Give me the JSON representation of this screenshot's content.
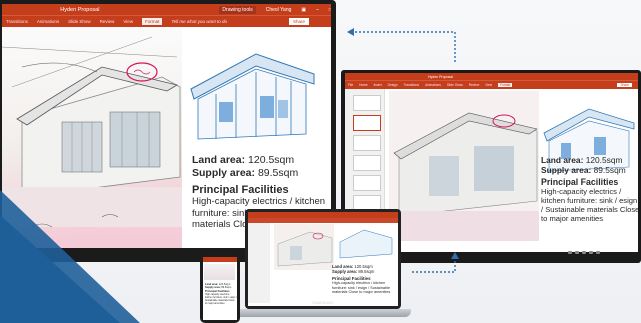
{
  "ppt": {
    "title": "Hyden Proposal",
    "context_tag": "Drawing tools",
    "user": "Cheol Yang",
    "tabs": [
      "Transitions",
      "Animations",
      "Slide Show",
      "Review",
      "View",
      "Format"
    ],
    "active_tab": "Format",
    "tell_me": "Tell me what you want to do",
    "share": "Share"
  },
  "slide": {
    "land_label": "Land area:",
    "land_value": "120.5sqm",
    "supply_label": "Supply area:",
    "supply_value": "89.5sqm",
    "section": "Principal Facilities",
    "description_main": "High-capacity electrics / kitchen furniture: sink / esign / Sustainable materials Close to major amenities",
    "description_right": "High-capacity electrics / kitchen furniture: sink / esign / Sustainable materials Close to major amenities"
  },
  "small_display": {
    "title": "Hyden Proposal",
    "tabs": [
      "File",
      "Home",
      "Insert",
      "Design",
      "Transitions",
      "Animations",
      "Slide Show",
      "Review",
      "View"
    ],
    "active_tab": "Format",
    "share": "Share"
  },
  "laptop": {
    "brand": "SAMSUNG"
  },
  "colors": {
    "ppt_red": "#c43e1c",
    "accent_blue": "#1f5f99"
  }
}
